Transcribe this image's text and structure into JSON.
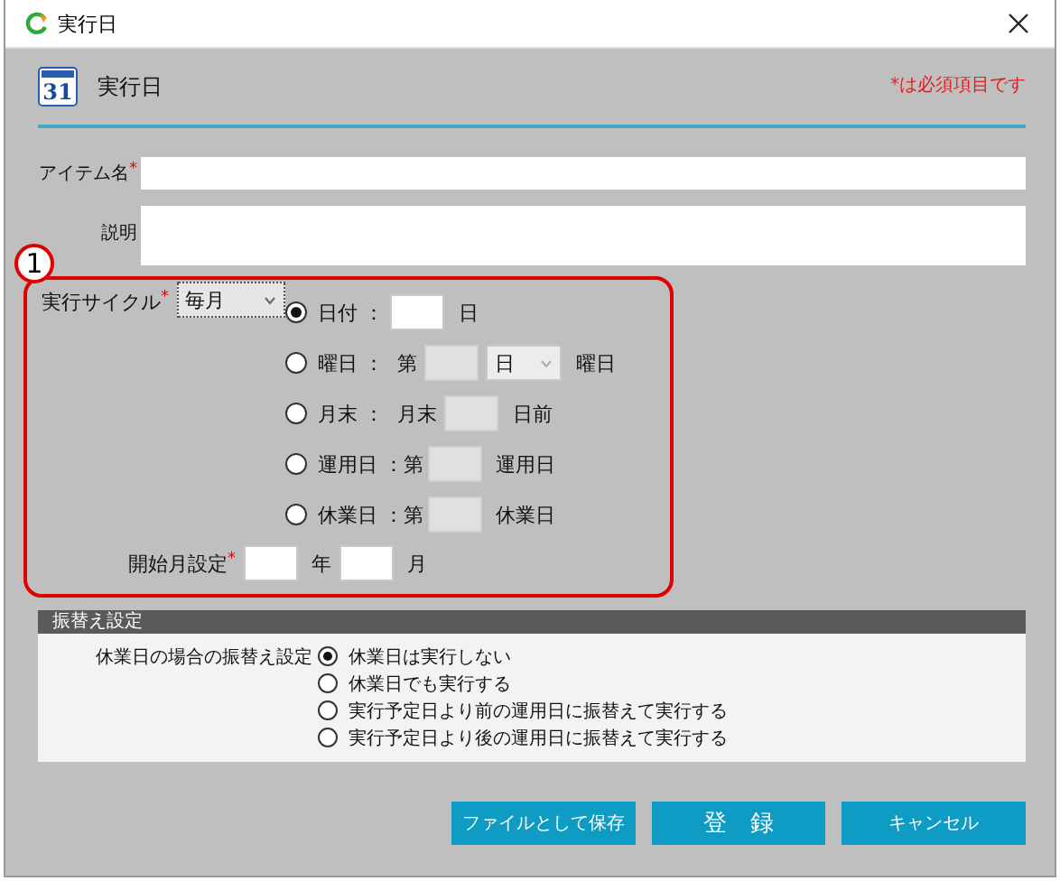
{
  "window": {
    "title": "実行日"
  },
  "header": {
    "title": "実行日",
    "calendar_day": "31",
    "required_note": "*は必須項目です"
  },
  "fields": [
    {
      "kind": "line",
      "label": "アイテム名",
      "mark": "*"
    },
    {
      "kind": "area",
      "label": "説明"
    }
  ],
  "callout": "1",
  "cycle": {
    "label": "実行サイクル",
    "mark": "*",
    "select": "毎月",
    "options": [
      {
        "kind": "date",
        "label": "日付 ：",
        "selected": true,
        "suffix": "日"
      },
      {
        "kind": "weekday",
        "label": "曜日 ：",
        "selected": false,
        "prefix": "第",
        "weekday": "日",
        "suffix": "曜日"
      },
      {
        "kind": "monthend",
        "label": "月末 ：",
        "selected": false,
        "prefix": "月末",
        "suffix": "日前"
      },
      {
        "kind": "numbered",
        "label": "運用日 ：",
        "selected": false,
        "prefix": "第",
        "suffix": "運用日"
      },
      {
        "kind": "numbered",
        "label": "休業日 ：",
        "selected": false,
        "prefix": "第",
        "suffix": "休業日"
      }
    ],
    "start": {
      "label": "開始月設定",
      "mark": "*",
      "year_unit": "年",
      "month_unit": "月"
    }
  },
  "transfer": {
    "title": "振替え設定",
    "label": "休業日の場合の振替え設定",
    "options": [
      {
        "label": "休業日は実行しない",
        "selected": true
      },
      {
        "label": "休業日でも実行する",
        "selected": false
      },
      {
        "label": "実行予定日より前の運用日に振替えて実行する",
        "selected": false
      },
      {
        "label": "実行予定日より後の運用日に振替えて実行する",
        "selected": false
      }
    ]
  },
  "buttons": [
    {
      "label": "ファイルとして保存",
      "kind": "normal"
    },
    {
      "label": "登　録",
      "kind": "wide"
    },
    {
      "label": "キャンセル",
      "kind": "normal"
    }
  ]
}
